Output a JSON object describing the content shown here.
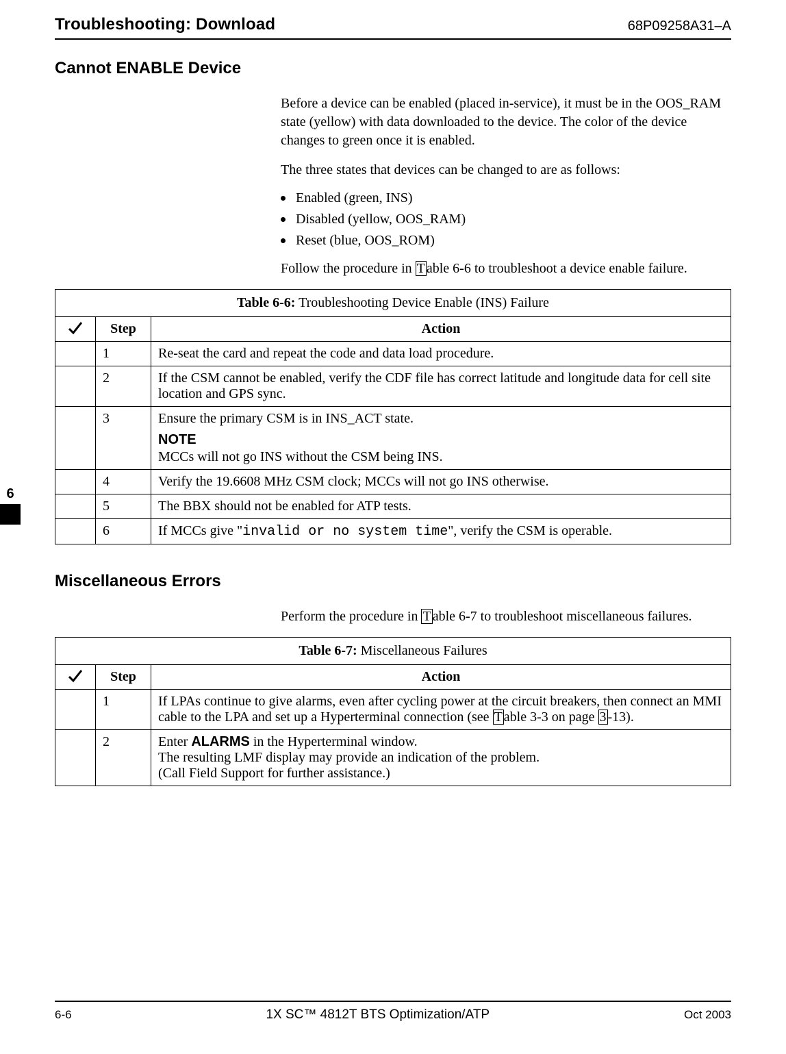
{
  "header": {
    "title": "Troubleshooting: Download",
    "code": "68P09258A31–A"
  },
  "sideTab": {
    "chapter": "6"
  },
  "sections": {
    "s1": {
      "heading": "Cannot ENABLE Device",
      "para1": "Before a device can be enabled (placed in-service), it must be in the OOS_RAM state (yellow) with data downloaded to the device. The color of the device changes to green once it is enabled.",
      "para2": "The three states that devices can be changed to are as follows:",
      "bullets": [
        "Enabled (green, INS)",
        "Disabled (yellow, OOS_RAM)",
        "Reset (blue, OOS_ROM)"
      ],
      "para3_a": "Follow the procedure in",
      "para3_link_left": "T",
      "para3_b": "able 6-6 to troubleshoot a device enable failure.",
      "table": {
        "number": "Table 6-6:",
        "title": "Troubleshooting Device Enable (INS) Failure",
        "cols": {
          "step": "Step",
          "action": "Action"
        },
        "rows": {
          "1": {
            "step": "1",
            "action": "Re-seat the card and repeat the code and data load procedure."
          },
          "2": {
            "step": "2",
            "action": "If the CSM cannot be enabled, verify the CDF file has correct latitude and longitude data for cell site location and GPS sync."
          },
          "3": {
            "step": "3",
            "action_a": "Ensure the primary CSM is in INS_ACT state.",
            "note_label": "NOTE",
            "note_text": "MCCs will not go INS without the CSM being INS."
          },
          "4": {
            "step": "4",
            "action": "Verify the 19.6608 MHz CSM clock; MCCs will not go INS otherwise."
          },
          "5": {
            "step": "5",
            "action": "The BBX should not be enabled for ATP tests."
          },
          "6": {
            "step": "6",
            "action_a": "If MCCs give \"",
            "mono": "invalid or no system time",
            "action_b": "\", verify the CSM is operable."
          }
        }
      }
    },
    "s2": {
      "heading": "Miscellaneous Errors",
      "para1_a": "Perform the procedure in",
      "para1_link_left": "T",
      "para1_b": "able 6-7 to troubleshoot miscellaneous failures.",
      "table": {
        "number": "Table 6-7:",
        "title": "Miscellaneous Failures",
        "cols": {
          "step": "Step",
          "action": "Action"
        },
        "rows": {
          "1": {
            "step": "1",
            "action_a": "If LPAs continue to give alarms, even after cycling power at the circuit breakers, then connect an MMI cable to the LPA and set up a Hyperterminal connection (see",
            "link1_left": "T",
            "action_b": "able 3-3 on page",
            "link2_left": "3",
            "action_c": "-13)."
          },
          "2": {
            "step": "2",
            "action_a": "Enter ",
            "bold": "ALARMS",
            "action_b": " in the Hyperterminal window.",
            "action_c": "The resulting LMF display may provide an indication of the problem.",
            "action_d": "(Call Field Support for further assistance.)"
          }
        }
      }
    }
  },
  "footer": {
    "pageNum": "6-6",
    "docTitle": "1X SC™ 4812T BTS Optimization/ATP",
    "date": "Oct 2003"
  }
}
